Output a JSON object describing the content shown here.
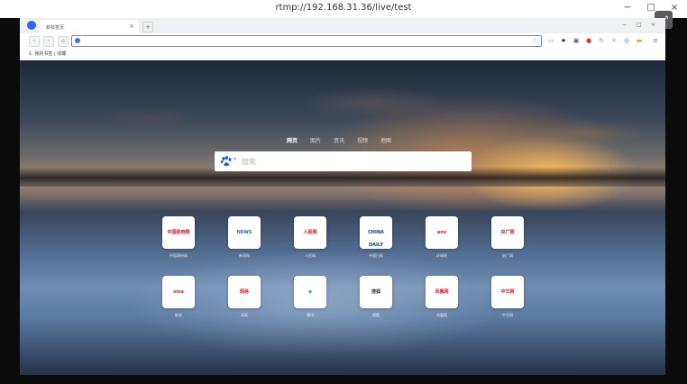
{
  "player": {
    "title": "rtmp://192.168.31.36/live/test",
    "minimize_label": "−",
    "maximize_label": "□",
    "close_label": "×",
    "fullscreen_label": "⤢"
  },
  "browser": {
    "tab_title": "新标签页",
    "tab_close_label": "×",
    "new_tab_label": "+",
    "inner_minimize_label": "−",
    "inner_maximize_label": "□",
    "inner_close_label": "×",
    "back_label": "‹",
    "forward_label": "›",
    "home_label": "⌂",
    "address_value": "",
    "bookmark_item": "1. 我的书签 | 收藏"
  },
  "search": {
    "tabs": [
      "网页",
      "图片",
      "资讯",
      "视频",
      "地图"
    ],
    "active_tab": "网页",
    "placeholder": "搜索"
  },
  "sites": [
    {
      "label": "中国政府网",
      "logo_text": "中国政府网",
      "color": "#c8161d"
    },
    {
      "label": "新浪网",
      "logo_text": "NEWS",
      "color": "#1c6ec4"
    },
    {
      "label": "人民网",
      "logo_text": "人民网",
      "color": "#d0151a"
    },
    {
      "label": "中国日报",
      "logo_text": "CHINA DAILY",
      "color": "#123d7a"
    },
    {
      "label": "环球网",
      "logo_text": "env",
      "color": "#c8161d"
    },
    {
      "label": "央广网",
      "logo_text": "央广网",
      "color": "#d61a1a"
    },
    {
      "label": "新浪",
      "logo_text": "sina",
      "color": "#d62a21"
    },
    {
      "label": "网易",
      "logo_text": "网易",
      "color": "#d31f25"
    },
    {
      "label": "腾讯",
      "logo_text": "◉",
      "color": "#2b8bd8"
    },
    {
      "label": "搜狐",
      "logo_text": "搜狐",
      "color": "#333333"
    },
    {
      "label": "凤凰网",
      "logo_text": "凤凰网",
      "color": "#d11f28"
    },
    {
      "label": "中华网",
      "logo_text": "中华网",
      "color": "#d31f25"
    }
  ]
}
